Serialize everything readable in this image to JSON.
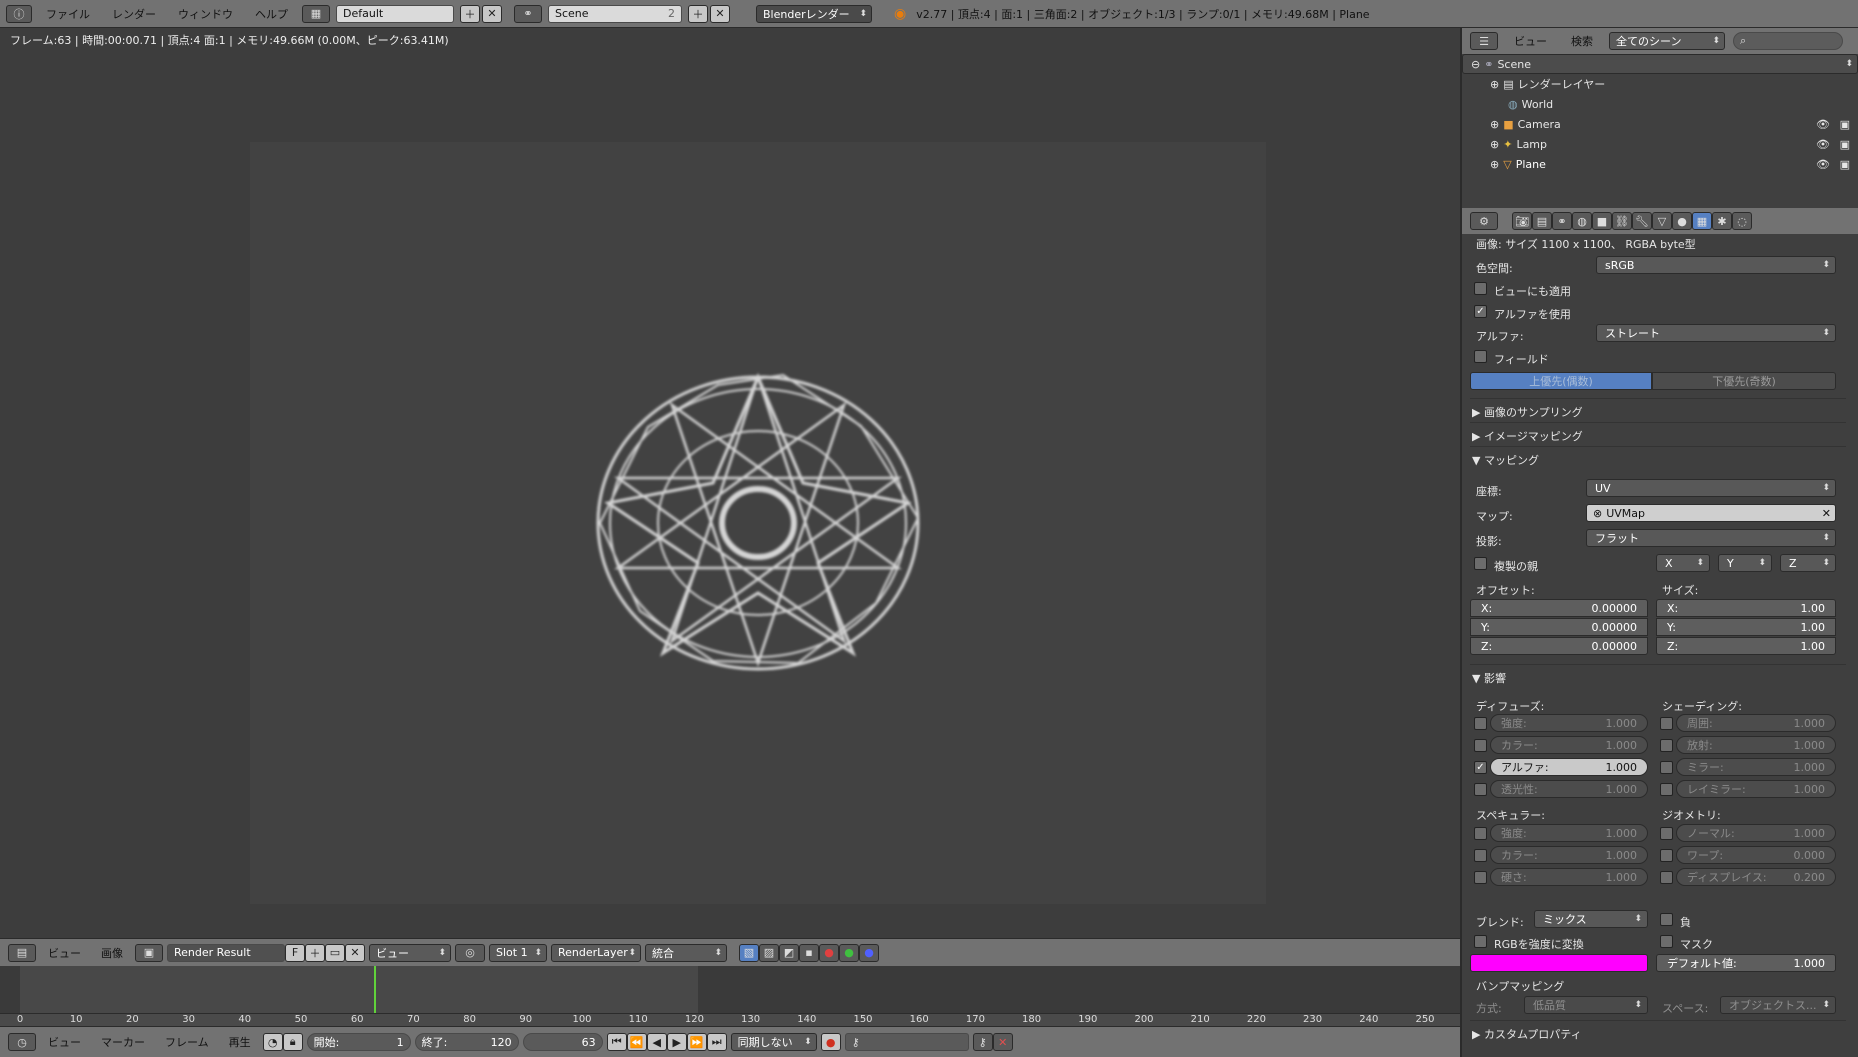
{
  "topbar": {
    "menus": [
      "ファイル",
      "レンダー",
      "ウィンドウ",
      "ヘルプ"
    ],
    "layout": "Default",
    "scene": "Scene",
    "scene_users": "2",
    "engine": "Blenderレンダー",
    "stats": "v2.77 | 頂点:4 | 面:1 | 三角面:2 | オブジェクト:1/3 | ランプ:0/1 | メモリ:49.68M | Plane"
  },
  "viewport": {
    "info": "フレーム:63 | 時間:00:00.71 | 頂点:4 面:1 | メモリ:49.66M (0.00M、ピーク:63.41M)"
  },
  "image_header": {
    "view": "ビュー",
    "image": "画像",
    "image_name": "Render Result",
    "fake_user": "F",
    "view_mode": "ビュー",
    "slot": "Slot 1",
    "layer": "RenderLayer",
    "pass": "統合"
  },
  "timeline": {
    "ticks": [
      "0",
      "10",
      "20",
      "30",
      "40",
      "50",
      "60",
      "70",
      "80",
      "90",
      "100",
      "110",
      "120",
      "130",
      "140",
      "150",
      "160",
      "170",
      "180",
      "190",
      "200",
      "210",
      "220",
      "230",
      "240",
      "250"
    ],
    "menus": [
      "ビュー",
      "マーカー",
      "フレーム",
      "再生"
    ],
    "start_label": "開始:",
    "start": "1",
    "end_label": "終了:",
    "end": "120",
    "current": "63",
    "sync": "同期しない"
  },
  "outliner": {
    "menus": [
      "ビュー",
      "検索"
    ],
    "scene_filter": "全てのシーン",
    "rows": [
      {
        "label": "Scene"
      },
      {
        "label": "レンダーレイヤー"
      },
      {
        "label": "World"
      },
      {
        "label": "Camera"
      },
      {
        "label": "Lamp"
      },
      {
        "label": "Plane"
      }
    ]
  },
  "props": {
    "image_info": "画像: サイズ 1100 x 1100、 RGBA byte型",
    "colorspace_label": "色空間:",
    "colorspace": "sRGB",
    "view_as_render": "ビューにも適用",
    "use_alpha": "アルファを使用",
    "alpha_label": "アルファ:",
    "alpha_mode": "ストレート",
    "fields": "フィールド",
    "field_upper": "上優先(偶数)",
    "field_lower": "下優先(奇数)",
    "panel_sampling": "画像のサンプリング",
    "panel_image_mapping": "イメージマッピング",
    "panel_mapping": "マッピング",
    "coords_label": "座標:",
    "coords": "UV",
    "map_label": "マップ:",
    "map": "UVMap",
    "projection_label": "投影:",
    "projection": "フラット",
    "from_dupli": "複製の親",
    "axis_x": "X",
    "axis_y": "Y",
    "axis_z": "Z",
    "offset_label": "オフセット:",
    "size_label": "サイズ:",
    "offset": [
      {
        "k": "X:",
        "v": "0.00000"
      },
      {
        "k": "Y:",
        "v": "0.00000"
      },
      {
        "k": "Z:",
        "v": "0.00000"
      }
    ],
    "size": [
      {
        "k": "X:",
        "v": "1.00"
      },
      {
        "k": "Y:",
        "v": "1.00"
      },
      {
        "k": "Z:",
        "v": "1.00"
      }
    ],
    "panel_influence": "影響",
    "diffuse_label": "ディフューズ:",
    "shading_label": "シェーディング:",
    "diffuse": [
      {
        "k": "強度:",
        "v": "1.000"
      },
      {
        "k": "カラー:",
        "v": "1.000"
      },
      {
        "k": "アルファ:",
        "v": "1.000"
      },
      {
        "k": "透光性:",
        "v": "1.000"
      }
    ],
    "shading": [
      {
        "k": "周囲:",
        "v": "1.000"
      },
      {
        "k": "放射:",
        "v": "1.000"
      },
      {
        "k": "ミラー:",
        "v": "1.000"
      },
      {
        "k": "レイミラー:",
        "v": "1.000"
      }
    ],
    "specular_label": "スペキュラー:",
    "geometry_label": "ジオメトリ:",
    "specular": [
      {
        "k": "強度:",
        "v": "1.000"
      },
      {
        "k": "カラー:",
        "v": "1.000"
      },
      {
        "k": "硬さ:",
        "v": "1.000"
      }
    ],
    "geometry": [
      {
        "k": "ノーマル:",
        "v": "1.000"
      },
      {
        "k": "ワープ:",
        "v": "0.000"
      },
      {
        "k": "ディスプレイス:",
        "v": "0.200"
      }
    ],
    "blend_label": "ブレンド:",
    "blend": "ミックス",
    "negative": "負",
    "rgb_to_intensity": "RGBを強度に変換",
    "stencil": "マスク",
    "default_value_label": "デフォルト値:",
    "default_value": "1.000",
    "color": "#ff00ff",
    "bump_label": "バンプマッピング",
    "method_label": "方式:",
    "method": "低品質",
    "space_label": "スペース:",
    "space": "オブジェクトス...",
    "custom_props": "カスタムプロパティ"
  }
}
